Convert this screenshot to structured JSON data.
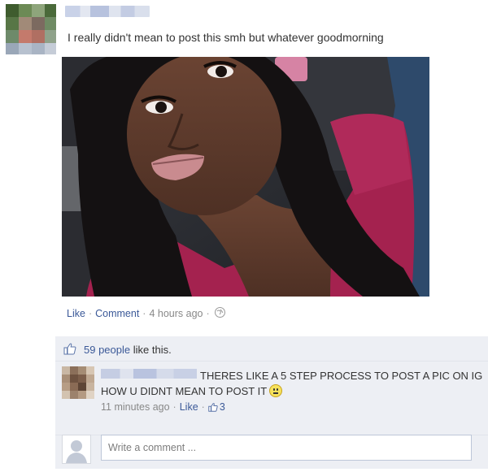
{
  "post": {
    "text": "I really didn't mean to post this smh but whatever goodmorning",
    "actions": {
      "like": "Like",
      "comment": "Comment",
      "time": "4 hours ago"
    }
  },
  "likes": {
    "count_text": "59 people",
    "suffix": " like this."
  },
  "comment": {
    "text": "THERES LIKE A 5 STEP PROCESS TO POST A PIC ON IG HOW U DIDNT MEAN TO POST IT",
    "time": "11 minutes ago",
    "like": "Like",
    "like_count": "3"
  },
  "composer": {
    "placeholder": "Write a comment ..."
  },
  "colors": {
    "link": "#3b5998",
    "ufi_background": "#edeff4"
  }
}
